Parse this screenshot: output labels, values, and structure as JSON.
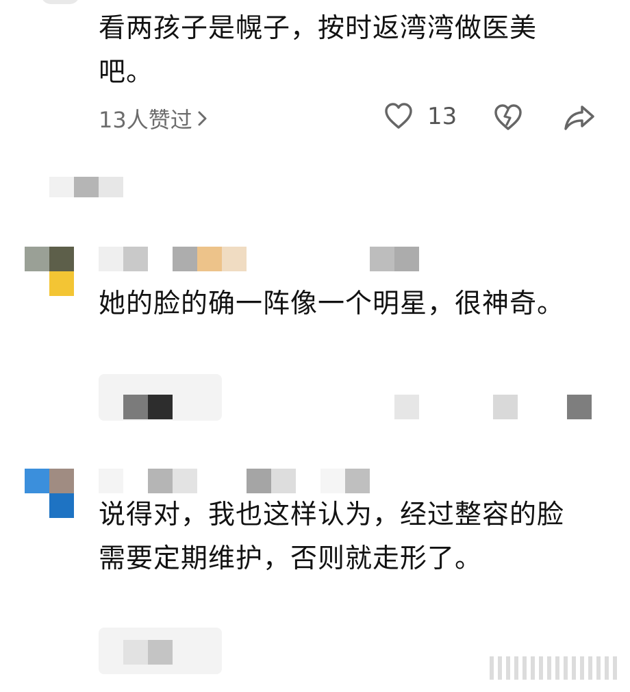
{
  "comments": [
    {
      "text": "看两孩子是幌子，按时返湾湾做医美吧。",
      "likes_summary": "13人赞过",
      "like_count": "13"
    },
    {
      "text": "她的脸的确一阵像一个明星，很神奇。"
    },
    {
      "text": "说得对，我也这样认为，经过整容的脸需要定期维护，否则就走形了。"
    }
  ],
  "icons": {
    "like": "heart-outline-icon",
    "dislike": "broken-heart-icon",
    "share": "share-arrow-icon",
    "chevron": "chevron-right-icon"
  },
  "colors": {
    "text": "#121212",
    "meta": "#6c6c6c",
    "icon": "#666666"
  }
}
